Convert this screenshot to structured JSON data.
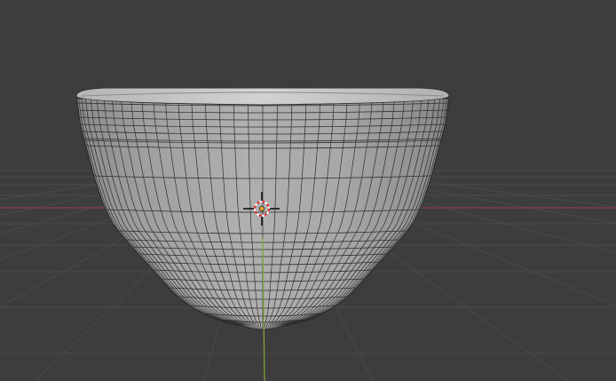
{
  "viewport": {
    "background": "#3d3d3d",
    "grid_color": "#4a4a4a",
    "x_axis_color": "#9a3c4a",
    "y_axis_color": "#7fa83a"
  },
  "object": {
    "name": "bowl-mesh",
    "shading": "solid",
    "wireframe_overlay": true,
    "base_color": "#a9a9a9",
    "rim_color": "#c4c4c4",
    "wire_color": "#2e2e2e"
  },
  "cursor_3d": {
    "icon": "3d-cursor-icon",
    "ring_colors": [
      "#ffffff",
      "#e02020"
    ]
  },
  "origin": {
    "icon": "object-origin-icon",
    "color": "#f5a623"
  }
}
